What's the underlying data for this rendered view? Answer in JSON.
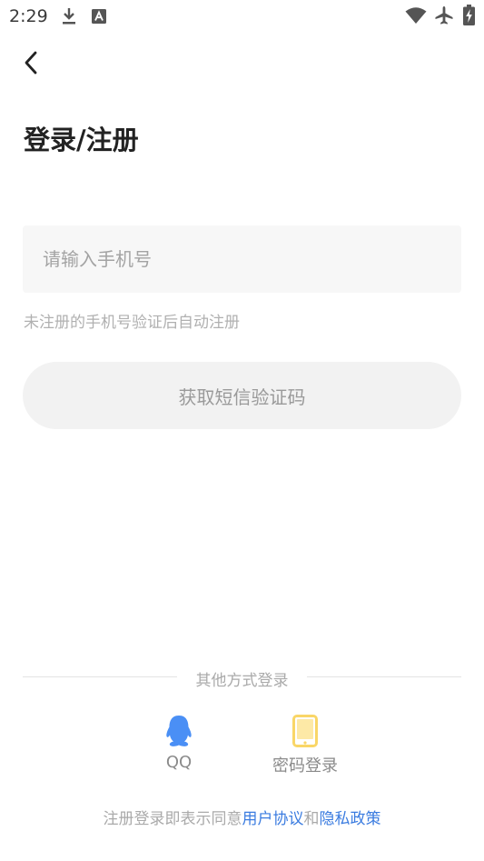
{
  "status_bar": {
    "time": "2:29",
    "left_icons": [
      "download-icon",
      "a-badge-icon"
    ],
    "right_icons": [
      "wifi-icon",
      "airplane-icon",
      "battery-charging-icon"
    ]
  },
  "header": {
    "back_icon": "chevron-left-icon",
    "title": "登录/注册"
  },
  "form": {
    "phone_placeholder": "请输入手机号",
    "phone_value": "",
    "hint": "未注册的手机号验证后自动注册",
    "get_code_label": "获取短信验证码"
  },
  "other_login": {
    "divider_label": "其他方式登录",
    "options": [
      {
        "label": "QQ",
        "icon": "qq-penguin-icon",
        "color": "#4a8ff5"
      },
      {
        "label": "密码登录",
        "icon": "phone-icon",
        "color": "#f9d667"
      }
    ]
  },
  "agreement": {
    "prefix": "注册登录即表示同意",
    "user_agreement": "用户协议",
    "conjunction": "和",
    "privacy_policy": "隐私政策",
    "link_color": "#3b7ce0"
  }
}
